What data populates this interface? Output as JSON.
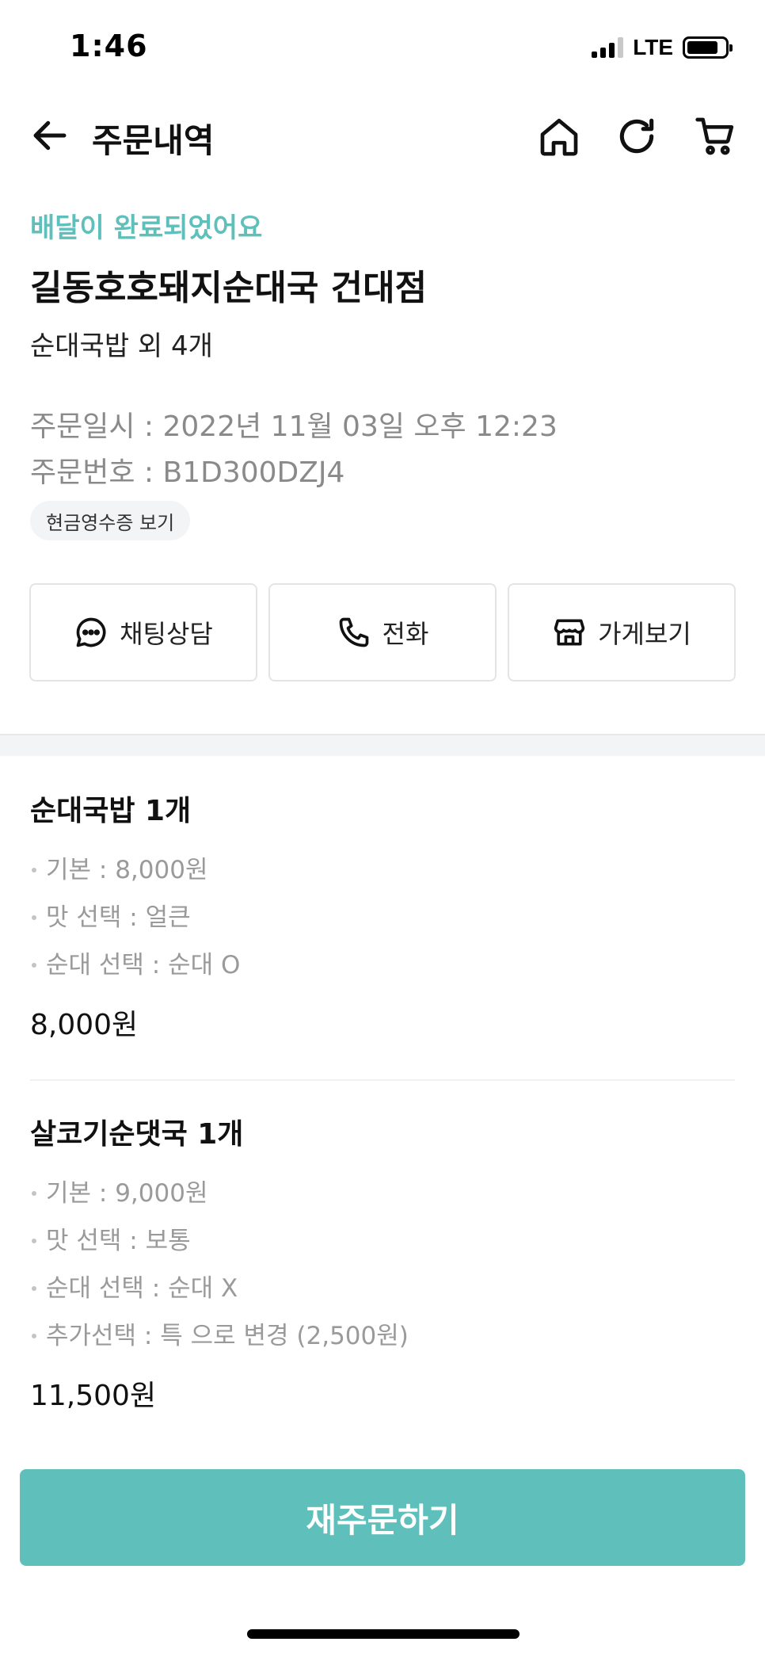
{
  "status_bar": {
    "time": "1:46",
    "network": "LTE"
  },
  "nav": {
    "title": "주문내역"
  },
  "summary": {
    "delivery_status": "배달이 완료되었어요",
    "store_name": "길동호호돼지순대국 건대점",
    "items_summary": "순대국밥 외 4개",
    "order_datetime": "주문일시 : 2022년 11월 03일 오후 12:23",
    "order_number": "주문번호 : B1D300DZJ4",
    "receipt_label": "현금영수증 보기"
  },
  "actions": {
    "chat_label": "채팅상담",
    "call_label": "전화",
    "store_label": "가게보기"
  },
  "menu_items": [
    {
      "name": "순대국밥 1개",
      "options": [
        "기본 : 8,000원",
        "맛 선택 : 얼큰",
        "순대 선택 : 순대 O"
      ],
      "price": "8,000원"
    },
    {
      "name": "살코기순댓국 1개",
      "options": [
        "기본 : 9,000원",
        "맛 선택 : 보통",
        "순대 선택 : 순대 X",
        "추가선택 : 특 으로 변경 (2,500원)"
      ],
      "price": "11,500원"
    }
  ],
  "reorder_label": "재주문하기",
  "colors": {
    "accent": "#5fc0bb",
    "meta_text": "#8a8a8a",
    "band": "#f3f4f6"
  }
}
